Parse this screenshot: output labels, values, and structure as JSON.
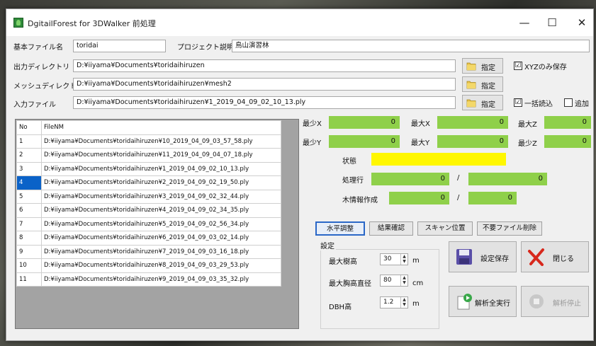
{
  "window": {
    "title": "DgitailForest for 3DWalker 前処理",
    "minimize": "—",
    "maximize": "☐",
    "close": "✕"
  },
  "top": {
    "base_file_label": "基本ファイル名",
    "base_file_value": "toridai",
    "project_desc_label": "プロジェクト説明",
    "project_desc_value": "鳥山演習林",
    "output_dir_label": "出力ディレクトリ",
    "output_dir_value": "D:¥iiyama¥Documents¥toridaihiruzen",
    "mesh_dir_label": "メッシュディレクトリ",
    "mesh_dir_value": "D:¥iiyama¥Documents¥toridaihiruzen¥mesh2",
    "input_file_label": "入力ファイル",
    "input_file_value": "D:¥iiyama¥Documents¥toridaihiruzen¥1_2019_04_09_02_10_13.ply",
    "specify_label": "指定",
    "xyz_only_label": "XYZのみ保存",
    "xyz_only_checked": "☑",
    "bulk_read_label": "一括読込",
    "bulk_read_checked": "☑",
    "add_label": "追加",
    "add_checked": ""
  },
  "grid": {
    "headers": [
      "No",
      "FileNM"
    ],
    "rows": [
      [
        "1",
        "D:¥iiyama¥Documents¥toridaihiruzen¥10_2019_04_09_03_57_58.ply"
      ],
      [
        "2",
        "D:¥iiyama¥Documents¥toridaihiruzen¥11_2019_04_09_04_07_18.ply"
      ],
      [
        "3",
        "D:¥iiyama¥Documents¥toridaihiruzen¥1_2019_04_09_02_10_13.ply"
      ],
      [
        "4",
        "D:¥iiyama¥Documents¥toridaihiruzen¥2_2019_04_09_02_19_50.ply"
      ],
      [
        "5",
        "D:¥iiyama¥Documents¥toridaihiruzen¥3_2019_04_09_02_32_44.ply"
      ],
      [
        "6",
        "D:¥iiyama¥Documents¥toridaihiruzen¥4_2019_04_09_02_34_35.ply"
      ],
      [
        "7",
        "D:¥iiyama¥Documents¥toridaihiruzen¥5_2019_04_09_02_56_34.ply"
      ],
      [
        "8",
        "D:¥iiyama¥Documents¥toridaihiruzen¥6_2019_04_09_03_02_14.ply"
      ],
      [
        "9",
        "D:¥iiyama¥Documents¥toridaihiruzen¥7_2019_04_09_03_16_18.ply"
      ],
      [
        "10",
        "D:¥iiyama¥Documents¥toridaihiruzen¥8_2019_04_09_03_29_53.ply"
      ],
      [
        "11",
        "D:¥iiyama¥Documents¥toridaihiruzen¥9_2019_04_09_03_35_32.ply"
      ]
    ],
    "selected_row": "4"
  },
  "bounds": {
    "min_x_label": "最少X",
    "min_x": "0",
    "max_x_label": "最大X",
    "max_x": "0",
    "max_z_label": "最大Z",
    "max_z": "0",
    "min_y_label": "最少Y",
    "min_y": "0",
    "max_y_label": "最大Y",
    "max_y": "0",
    "min_z_label": "最少Z",
    "min_z": "0"
  },
  "status": {
    "state_label": "状態",
    "rows_label": "処理行",
    "rows_value": "0",
    "rows_sep": "/",
    "rows_total": "0",
    "tree_label": "木情報作成",
    "tree_value": "0",
    "tree_sep": "/",
    "tree_total": "0"
  },
  "tabs": [
    "水平調整",
    "結果確認",
    "スキャン位置",
    "不要ファイル削除"
  ],
  "settings": {
    "title": "設定",
    "max_height_label": "最大樹高",
    "max_height_value": "30",
    "max_height_unit": "m",
    "max_dbh_label": "最大胸高直径",
    "max_dbh_value": "80",
    "max_dbh_unit": "cm",
    "dbh_height_label": "DBH高",
    "dbh_height_value": "1.2",
    "dbh_height_unit": "m",
    "spin_up": "▲",
    "spin_down": "▼"
  },
  "actions": {
    "save_label": "設定保存",
    "close_label": "閉じる",
    "analyze_all_label": "解析全実行",
    "stop_label": "解析停止"
  }
}
